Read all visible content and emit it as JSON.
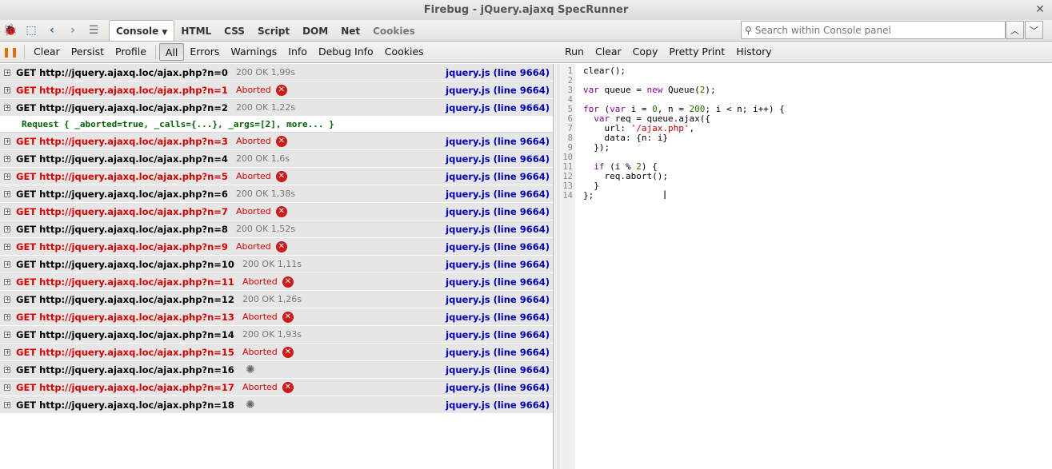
{
  "window": {
    "title": "Firebug - jQuery.ajaxq SpecRunner",
    "close_glyph": "✕"
  },
  "toolbar": {
    "panel_tabs": [
      {
        "label": "Console"
      },
      {
        "label": "HTML"
      },
      {
        "label": "CSS"
      },
      {
        "label": "Script"
      },
      {
        "label": "DOM"
      },
      {
        "label": "Net"
      },
      {
        "label": "Cookies"
      }
    ],
    "search_placeholder": "Search within Console panel"
  },
  "console_toolbar": {
    "clear": "Clear",
    "persist": "Persist",
    "profile": "Profile",
    "filters": [
      "All",
      "Errors",
      "Warnings",
      "Info",
      "Debug Info",
      "Cookies"
    ]
  },
  "editor_toolbar": [
    "Run",
    "Clear",
    "Copy",
    "Pretty Print",
    "History"
  ],
  "console": {
    "rows": [
      {
        "req": "GET http://jquery.ajaxq.loc/ajax.php?n=0",
        "status": "200 OK 1,99s",
        "error": false,
        "pending": false,
        "src": "jquery.js (line 9664)"
      },
      {
        "req": "GET http://jquery.ajaxq.loc/ajax.php?n=1",
        "status": "Aborted",
        "error": true,
        "pending": false,
        "src": "jquery.js (line 9664)"
      },
      {
        "req": "GET http://jquery.ajaxq.loc/ajax.php?n=2",
        "status": "200 OK 1,22s",
        "error": false,
        "pending": false,
        "src": "jquery.js (line 9664)"
      },
      {
        "req": "GET http://jquery.ajaxq.loc/ajax.php?n=3",
        "status": "Aborted",
        "error": true,
        "pending": false,
        "src": "jquery.js (line 9664)"
      },
      {
        "req": "GET http://jquery.ajaxq.loc/ajax.php?n=4",
        "status": "200 OK 1,6s",
        "error": false,
        "pending": false,
        "src": "jquery.js (line 9664)"
      },
      {
        "req": "GET http://jquery.ajaxq.loc/ajax.php?n=5",
        "status": "Aborted",
        "error": true,
        "pending": false,
        "src": "jquery.js (line 9664)"
      },
      {
        "req": "GET http://jquery.ajaxq.loc/ajax.php?n=6",
        "status": "200 OK 1,38s",
        "error": false,
        "pending": false,
        "src": "jquery.js (line 9664)"
      },
      {
        "req": "GET http://jquery.ajaxq.loc/ajax.php?n=7",
        "status": "Aborted",
        "error": true,
        "pending": false,
        "src": "jquery.js (line 9664)"
      },
      {
        "req": "GET http://jquery.ajaxq.loc/ajax.php?n=8",
        "status": "200 OK 1,52s",
        "error": false,
        "pending": false,
        "src": "jquery.js (line 9664)"
      },
      {
        "req": "GET http://jquery.ajaxq.loc/ajax.php?n=9",
        "status": "Aborted",
        "error": true,
        "pending": false,
        "src": "jquery.js (line 9664)"
      },
      {
        "req": "GET http://jquery.ajaxq.loc/ajax.php?n=10",
        "status": "200 OK 1,11s",
        "error": false,
        "pending": false,
        "src": "jquery.js (line 9664)"
      },
      {
        "req": "GET http://jquery.ajaxq.loc/ajax.php?n=11",
        "status": "Aborted",
        "error": true,
        "pending": false,
        "src": "jquery.js (line 9664)"
      },
      {
        "req": "GET http://jquery.ajaxq.loc/ajax.php?n=12",
        "status": "200 OK 1,26s",
        "error": false,
        "pending": false,
        "src": "jquery.js (line 9664)"
      },
      {
        "req": "GET http://jquery.ajaxq.loc/ajax.php?n=13",
        "status": "Aborted",
        "error": true,
        "pending": false,
        "src": "jquery.js (line 9664)"
      },
      {
        "req": "GET http://jquery.ajaxq.loc/ajax.php?n=14",
        "status": "200 OK 1,93s",
        "error": false,
        "pending": false,
        "src": "jquery.js (line 9664)"
      },
      {
        "req": "GET http://jquery.ajaxq.loc/ajax.php?n=15",
        "status": "Aborted",
        "error": true,
        "pending": false,
        "src": "jquery.js (line 9664)"
      },
      {
        "req": "GET http://jquery.ajaxq.loc/ajax.php?n=16",
        "status": "",
        "error": false,
        "pending": true,
        "src": "jquery.js (line 9664)"
      },
      {
        "req": "GET http://jquery.ajaxq.loc/ajax.php?n=17",
        "status": "Aborted",
        "error": true,
        "pending": false,
        "src": "jquery.js (line 9664)"
      },
      {
        "req": "GET http://jquery.ajaxq.loc/ajax.php?n=18",
        "status": "",
        "error": false,
        "pending": true,
        "src": "jquery.js (line 9664)"
      }
    ],
    "expanded_detail": "Request { _aborted=true, _calls={...}, _args=[2], more... }",
    "expanded_after_row": 2
  },
  "editor": {
    "line_numbers": [
      "1",
      "2",
      "3",
      "4",
      "5",
      "6",
      "7",
      "8",
      "9",
      "10",
      "11",
      "12",
      "13",
      "14"
    ],
    "code_lines": [
      "clear();",
      "",
      "var queue = new Queue(2);",
      "",
      "for (var i = 0, n = 200; i < n; i++) {",
      "  var req = queue.ajax({",
      "    url: '/ajax.php',",
      "    data: {n: i}",
      "  });",
      "",
      "  if (i % 2) {",
      "    req.abort();",
      "  }",
      "};"
    ]
  },
  "colors": {
    "error": "#e00000",
    "link": "#0000c8",
    "ok_status": "#777777",
    "row_bg": "#e6e6e6"
  }
}
